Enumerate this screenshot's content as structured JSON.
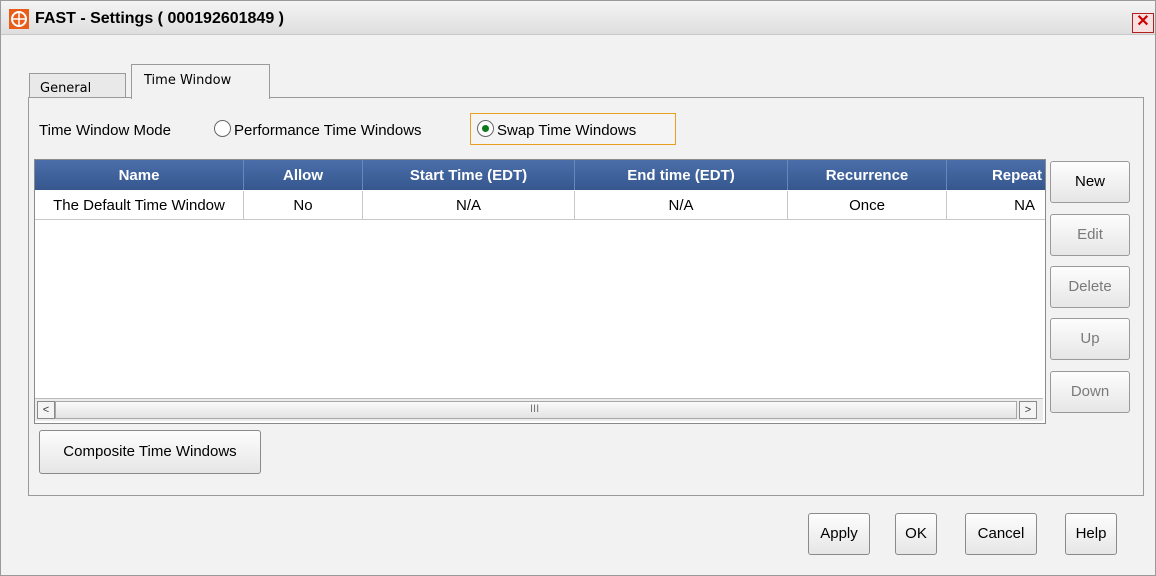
{
  "window": {
    "title": "FAST - Settings ( 000192601849 )",
    "close_glyph": "✕"
  },
  "tabs": [
    {
      "label": "General",
      "selected": false
    },
    {
      "label": "Time Window",
      "selected": true
    }
  ],
  "mode": {
    "label": "Time Window Mode",
    "options": [
      {
        "label": "Performance Time Windows",
        "selected": false
      },
      {
        "label": "Swap Time Windows",
        "selected": true
      }
    ]
  },
  "table": {
    "columns": [
      "Name",
      "Allow",
      "Start Time (EDT)",
      "End time (EDT)",
      "Recurrence",
      "Repeat"
    ],
    "rows": [
      [
        "The Default Time Window",
        "No",
        "N/A",
        "N/A",
        "Once",
        "NA"
      ]
    ],
    "scroll_left_glyph": "<",
    "scroll_right_glyph": ">",
    "scroll_grip": "III"
  },
  "side_buttons": {
    "new": "New",
    "edit": "Edit",
    "delete": "Delete",
    "up": "Up",
    "down": "Down"
  },
  "composite_button": "Composite Time Windows",
  "footer": {
    "apply": "Apply",
    "ok": "OK",
    "cancel": "Cancel",
    "help": "Help"
  },
  "colors": {
    "header_bg": "#3f62a0",
    "focus_border": "#e8a020",
    "radio_selected": "#0a7a1a"
  },
  "icons": {
    "app": "fast-app-icon",
    "close": "close-icon"
  }
}
